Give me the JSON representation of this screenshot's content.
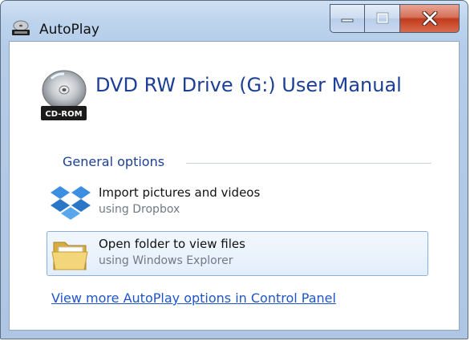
{
  "window": {
    "title": "AutoPlay",
    "controls": {
      "minimize": "minimize",
      "maximize": "maximize",
      "close": "close"
    }
  },
  "drive": {
    "title": "DVD RW Drive (G:) User Manual",
    "badge": "CD-ROM"
  },
  "section": {
    "label": "General options"
  },
  "options": [
    {
      "title": "Import pictures and videos",
      "subtitle": "using Dropbox",
      "icon": "dropbox-icon"
    },
    {
      "title": "Open folder to view files",
      "subtitle": "using Windows Explorer",
      "icon": "folder-icon",
      "selected": true
    }
  ],
  "link": {
    "label": "View more AutoPlay options in Control Panel"
  },
  "colors": {
    "heading": "#1c3f95",
    "link": "#1e56c9",
    "close": "#c23a1d"
  }
}
